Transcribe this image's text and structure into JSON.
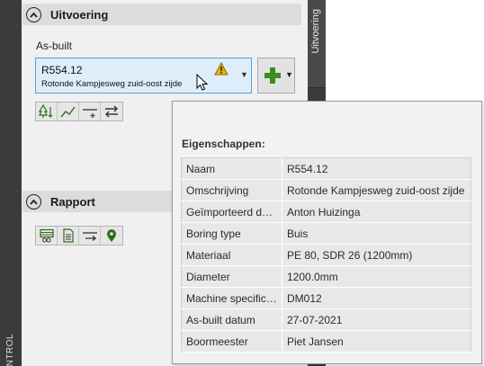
{
  "left_strip": {
    "label": "NTROL"
  },
  "side_tab": {
    "label": "Uitvoering"
  },
  "uitvoering": {
    "title": "Uitvoering",
    "asbuilt_label": "As-built",
    "selected": {
      "name": "R554.12",
      "description": "Rotonde Kampjesweg zuid-oost zijde"
    },
    "status_icon": "warning-icon",
    "add_icon": "plus-icon",
    "toolbar_icons": [
      "tree-icon",
      "profile-icon",
      "insert-line-icon",
      "swap-icon"
    ]
  },
  "rapport": {
    "title": "Rapport",
    "toolbar_icons": [
      "table-icon",
      "document-icon",
      "arrow-line-icon",
      "location-pin-icon"
    ]
  },
  "properties": {
    "title": "Eigenschappen:",
    "rows": [
      {
        "key": "Naam",
        "value": "R554.12"
      },
      {
        "key": "Omschrijving",
        "value": "Rotonde Kampjesweg zuid-oost zijde"
      },
      {
        "key": "Geïmporteerd door",
        "value": "Anton Huizinga"
      },
      {
        "key": "Boring type",
        "value": "Buis"
      },
      {
        "key": "Materiaal",
        "value": "PE 80, SDR 26 (1200mm)"
      },
      {
        "key": "Diameter",
        "value": "1200.0mm"
      },
      {
        "key": "Machine specifica...",
        "value": "DM012"
      },
      {
        "key": "As-built datum",
        "value": "27-07-2021"
      },
      {
        "key": "Boormeester",
        "value": "Piet Jansen"
      }
    ]
  },
  "colors": {
    "accent": "#5aa0d6",
    "combo_bg": "#ddeefa",
    "plus": "#3c8c1e",
    "warning": "#e8b400"
  }
}
